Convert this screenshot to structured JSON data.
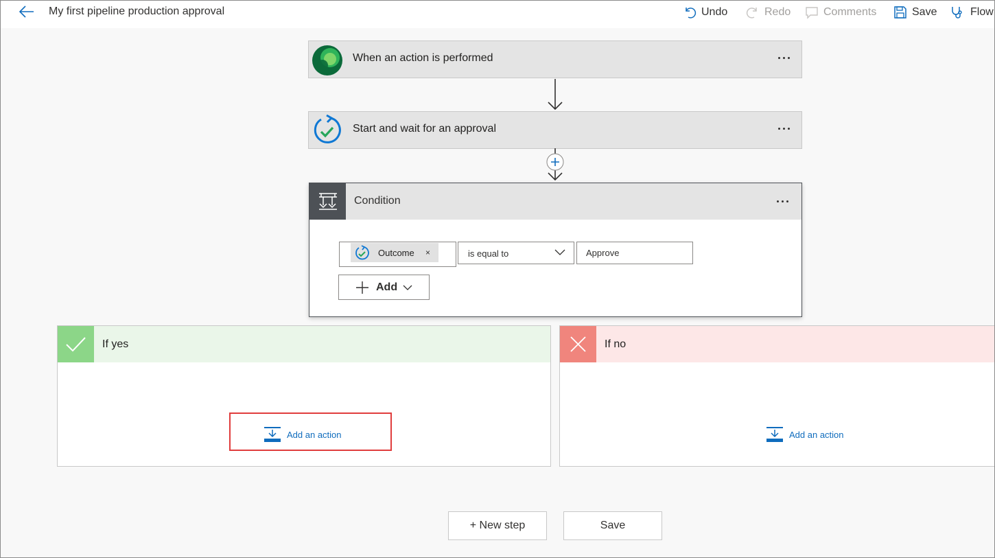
{
  "header": {
    "title": "My first pipeline production approval",
    "undo": "Undo",
    "redo": "Redo",
    "comments": "Comments",
    "save": "Save",
    "flow_checker": "Flow"
  },
  "steps": [
    {
      "label": "When an action is performed",
      "icon": "dataverse-icon"
    },
    {
      "label": "Start and wait for an approval",
      "icon": "approval-icon"
    }
  ],
  "condition": {
    "label": "Condition",
    "operand_token": "Outcome",
    "operator": "is equal to",
    "value": "Approve",
    "add_label": "Add"
  },
  "branches": {
    "yes": {
      "title": "If yes",
      "add_action": "Add an action",
      "color": "#8cd688"
    },
    "no": {
      "title": "If no",
      "add_action": "Add an action",
      "color": "#f0857d"
    }
  },
  "footer": {
    "new_step": "+ New step",
    "save": "Save"
  }
}
